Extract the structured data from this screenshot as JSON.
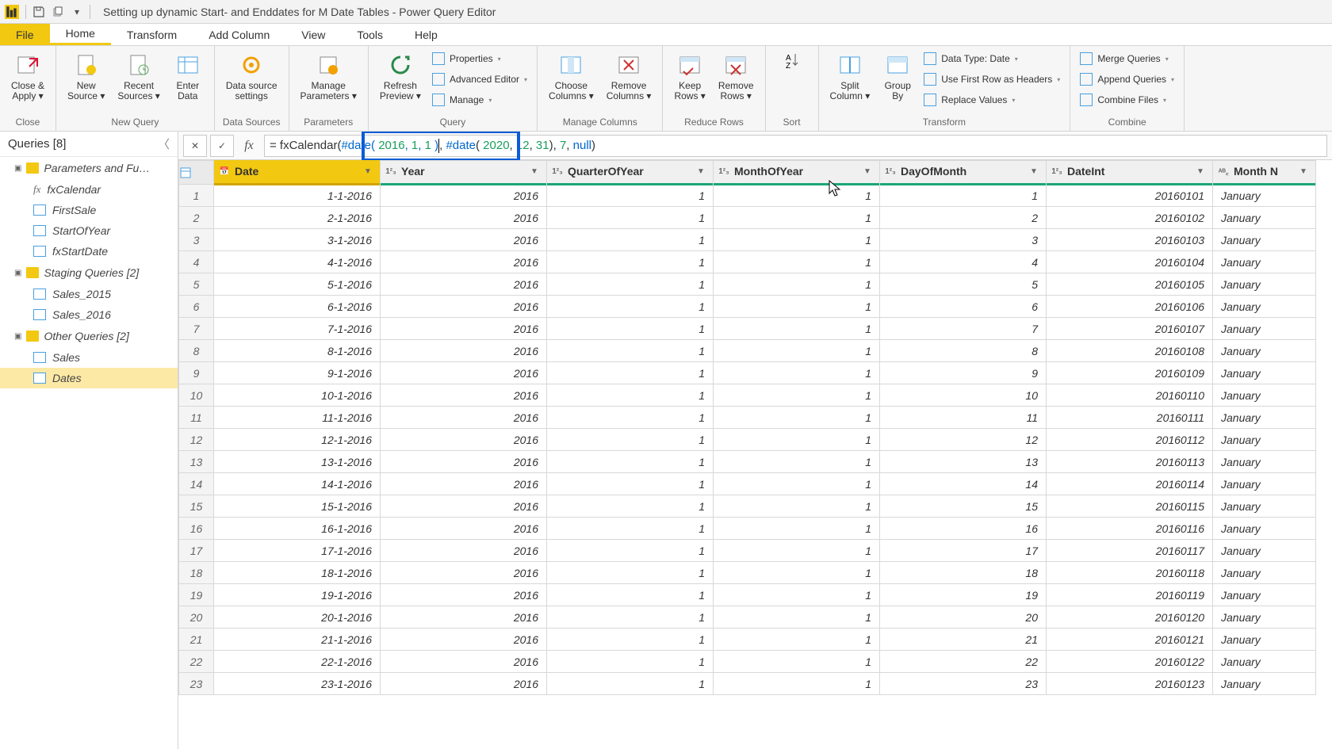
{
  "titleBar": {
    "title": "Setting up dynamic Start- and Enddates for M Date Tables - Power Query Editor"
  },
  "menuTabs": {
    "file": "File",
    "items": [
      "Home",
      "Transform",
      "Add Column",
      "View",
      "Tools",
      "Help"
    ],
    "activeIndex": 0
  },
  "ribbon": {
    "groups": [
      {
        "label": "Close",
        "big": [
          {
            "l1": "Close &",
            "l2": "Apply",
            "drop": true
          }
        ]
      },
      {
        "label": "New Query",
        "big": [
          {
            "l1": "New",
            "l2": "Source",
            "drop": true
          },
          {
            "l1": "Recent",
            "l2": "Sources",
            "drop": true
          },
          {
            "l1": "Enter",
            "l2": "Data"
          }
        ]
      },
      {
        "label": "Data Sources",
        "big": [
          {
            "l1": "Data source",
            "l2": "settings"
          }
        ]
      },
      {
        "label": "Parameters",
        "big": [
          {
            "l1": "Manage",
            "l2": "Parameters",
            "drop": true
          }
        ]
      },
      {
        "label": "Query",
        "big": [
          {
            "l1": "Refresh",
            "l2": "Preview",
            "drop": true
          }
        ],
        "small": [
          "Properties",
          "Advanced Editor",
          "Manage"
        ]
      },
      {
        "label": "Manage Columns",
        "big": [
          {
            "l1": "Choose",
            "l2": "Columns",
            "drop": true
          },
          {
            "l1": "Remove",
            "l2": "Columns",
            "drop": true
          }
        ]
      },
      {
        "label": "Reduce Rows",
        "big": [
          {
            "l1": "Keep",
            "l2": "Rows",
            "drop": true
          },
          {
            "l1": "Remove",
            "l2": "Rows",
            "drop": true
          }
        ]
      },
      {
        "label": "Sort",
        "big": []
      },
      {
        "label": "Transform",
        "big": [
          {
            "l1": "Split",
            "l2": "Column",
            "drop": true
          },
          {
            "l1": "Group",
            "l2": "By"
          }
        ],
        "small": [
          "Data Type: Date",
          "Use First Row as Headers",
          "Replace Values"
        ]
      },
      {
        "label": "Combine",
        "big": [],
        "small": [
          "Merge Queries",
          "Append Queries",
          "Combine Files"
        ]
      }
    ]
  },
  "queriesPane": {
    "header": "Queries [8]",
    "groups": [
      {
        "name": "Parameters and Fu…",
        "items": [
          {
            "name": "fxCalendar",
            "type": "fx"
          },
          {
            "name": "FirstSale",
            "type": "table"
          },
          {
            "name": "StartOfYear",
            "type": "table"
          },
          {
            "name": "fxStartDate",
            "type": "table"
          }
        ]
      },
      {
        "name": "Staging Queries [2]",
        "items": [
          {
            "name": "Sales_2015",
            "type": "table"
          },
          {
            "name": "Sales_2016",
            "type": "table"
          }
        ]
      },
      {
        "name": "Other Queries [2]",
        "items": [
          {
            "name": "Sales",
            "type": "table"
          },
          {
            "name": "Dates",
            "type": "table",
            "selected": true
          }
        ]
      }
    ]
  },
  "formulaBar": {
    "prefix": "= fxCalendar(",
    "highlighted": "#date( 2016, 1, 1 )",
    "rest": ", #date( 2020, 12, 31), 7, null)"
  },
  "grid": {
    "columns": [
      {
        "name": "Date",
        "type": "date",
        "selected": true
      },
      {
        "name": "Year",
        "type": "num"
      },
      {
        "name": "QuarterOfYear",
        "type": "num"
      },
      {
        "name": "MonthOfYear",
        "type": "num"
      },
      {
        "name": "DayOfMonth",
        "type": "num"
      },
      {
        "name": "DateInt",
        "type": "num"
      },
      {
        "name": "Month N",
        "type": "text"
      }
    ],
    "rows": [
      {
        "n": 1,
        "date": "1-1-2016",
        "year": 2016,
        "q": 1,
        "m": 1,
        "d": 1,
        "di": 20160101,
        "mn": "January"
      },
      {
        "n": 2,
        "date": "2-1-2016",
        "year": 2016,
        "q": 1,
        "m": 1,
        "d": 2,
        "di": 20160102,
        "mn": "January"
      },
      {
        "n": 3,
        "date": "3-1-2016",
        "year": 2016,
        "q": 1,
        "m": 1,
        "d": 3,
        "di": 20160103,
        "mn": "January"
      },
      {
        "n": 4,
        "date": "4-1-2016",
        "year": 2016,
        "q": 1,
        "m": 1,
        "d": 4,
        "di": 20160104,
        "mn": "January"
      },
      {
        "n": 5,
        "date": "5-1-2016",
        "year": 2016,
        "q": 1,
        "m": 1,
        "d": 5,
        "di": 20160105,
        "mn": "January"
      },
      {
        "n": 6,
        "date": "6-1-2016",
        "year": 2016,
        "q": 1,
        "m": 1,
        "d": 6,
        "di": 20160106,
        "mn": "January"
      },
      {
        "n": 7,
        "date": "7-1-2016",
        "year": 2016,
        "q": 1,
        "m": 1,
        "d": 7,
        "di": 20160107,
        "mn": "January"
      },
      {
        "n": 8,
        "date": "8-1-2016",
        "year": 2016,
        "q": 1,
        "m": 1,
        "d": 8,
        "di": 20160108,
        "mn": "January"
      },
      {
        "n": 9,
        "date": "9-1-2016",
        "year": 2016,
        "q": 1,
        "m": 1,
        "d": 9,
        "di": 20160109,
        "mn": "January"
      },
      {
        "n": 10,
        "date": "10-1-2016",
        "year": 2016,
        "q": 1,
        "m": 1,
        "d": 10,
        "di": 20160110,
        "mn": "January"
      },
      {
        "n": 11,
        "date": "11-1-2016",
        "year": 2016,
        "q": 1,
        "m": 1,
        "d": 11,
        "di": 20160111,
        "mn": "January"
      },
      {
        "n": 12,
        "date": "12-1-2016",
        "year": 2016,
        "q": 1,
        "m": 1,
        "d": 12,
        "di": 20160112,
        "mn": "January"
      },
      {
        "n": 13,
        "date": "13-1-2016",
        "year": 2016,
        "q": 1,
        "m": 1,
        "d": 13,
        "di": 20160113,
        "mn": "January"
      },
      {
        "n": 14,
        "date": "14-1-2016",
        "year": 2016,
        "q": 1,
        "m": 1,
        "d": 14,
        "di": 20160114,
        "mn": "January"
      },
      {
        "n": 15,
        "date": "15-1-2016",
        "year": 2016,
        "q": 1,
        "m": 1,
        "d": 15,
        "di": 20160115,
        "mn": "January"
      },
      {
        "n": 16,
        "date": "16-1-2016",
        "year": 2016,
        "q": 1,
        "m": 1,
        "d": 16,
        "di": 20160116,
        "mn": "January"
      },
      {
        "n": 17,
        "date": "17-1-2016",
        "year": 2016,
        "q": 1,
        "m": 1,
        "d": 17,
        "di": 20160117,
        "mn": "January"
      },
      {
        "n": 18,
        "date": "18-1-2016",
        "year": 2016,
        "q": 1,
        "m": 1,
        "d": 18,
        "di": 20160118,
        "mn": "January"
      },
      {
        "n": 19,
        "date": "19-1-2016",
        "year": 2016,
        "q": 1,
        "m": 1,
        "d": 19,
        "di": 20160119,
        "mn": "January"
      },
      {
        "n": 20,
        "date": "20-1-2016",
        "year": 2016,
        "q": 1,
        "m": 1,
        "d": 20,
        "di": 20160120,
        "mn": "January"
      },
      {
        "n": 21,
        "date": "21-1-2016",
        "year": 2016,
        "q": 1,
        "m": 1,
        "d": 21,
        "di": 20160121,
        "mn": "January"
      },
      {
        "n": 22,
        "date": "22-1-2016",
        "year": 2016,
        "q": 1,
        "m": 1,
        "d": 22,
        "di": 20160122,
        "mn": "January"
      },
      {
        "n": 23,
        "date": "23-1-2016",
        "year": 2016,
        "q": 1,
        "m": 1,
        "d": 23,
        "di": 20160123,
        "mn": "January"
      }
    ]
  }
}
